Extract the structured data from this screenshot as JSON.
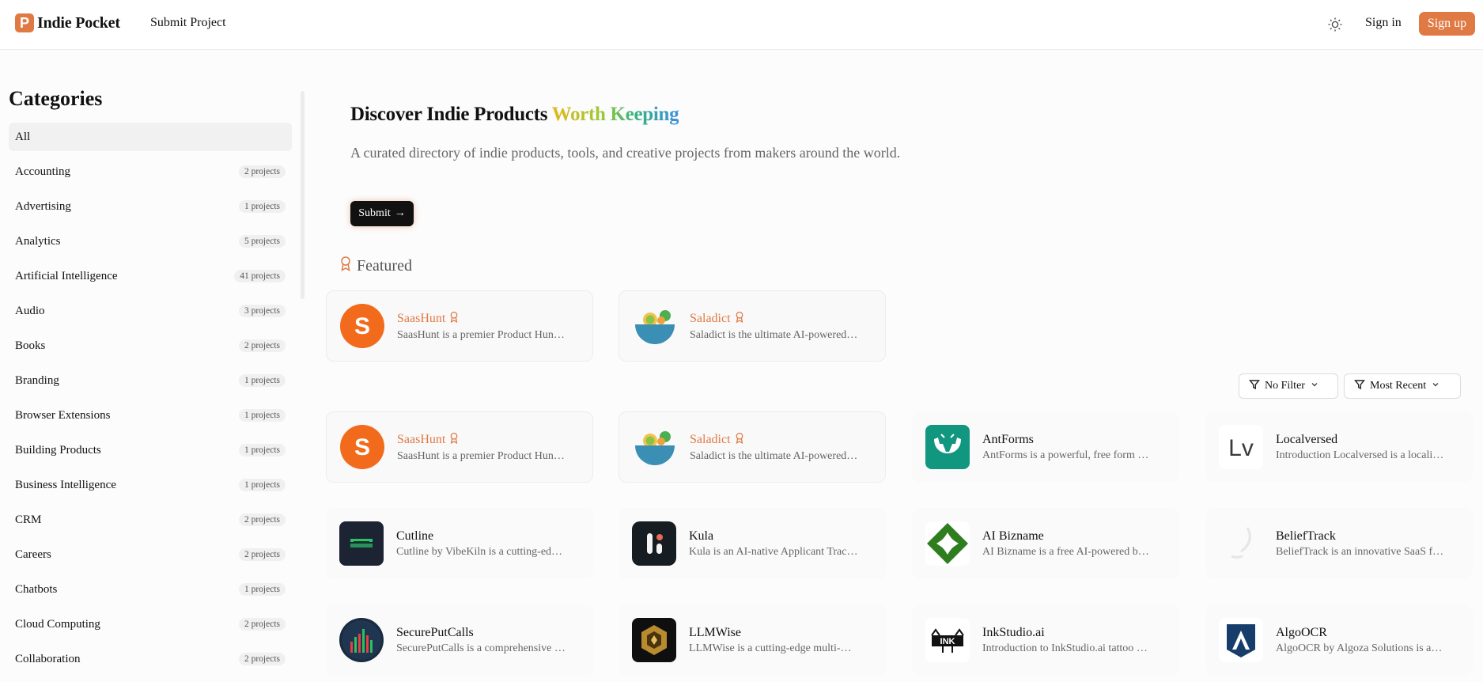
{
  "header": {
    "brand_letter": "P",
    "brand_name": "Indie Pocket",
    "nav_submit": "Submit Project",
    "sign_in": "Sign in",
    "sign_up": "Sign up",
    "accent_color": "#e07a45"
  },
  "sidebar": {
    "title": "Categories",
    "categories": [
      {
        "name": "All",
        "count": ""
      },
      {
        "name": "Accounting",
        "count": "2 projects"
      },
      {
        "name": "Advertising",
        "count": "1 projects"
      },
      {
        "name": "Analytics",
        "count": "5 projects"
      },
      {
        "name": "Artificial Intelligence",
        "count": "41 projects"
      },
      {
        "name": "Audio",
        "count": "3 projects"
      },
      {
        "name": "Books",
        "count": "2 projects"
      },
      {
        "name": "Branding",
        "count": "1 projects"
      },
      {
        "name": "Browser Extensions",
        "count": "1 projects"
      },
      {
        "name": "Building Products",
        "count": "1 projects"
      },
      {
        "name": "Business Intelligence",
        "count": "1 projects"
      },
      {
        "name": "CRM",
        "count": "2 projects"
      },
      {
        "name": "Careers",
        "count": "2 projects"
      },
      {
        "name": "Chatbots",
        "count": "1 projects"
      },
      {
        "name": "Cloud Computing",
        "count": "2 projects"
      },
      {
        "name": "Collaboration",
        "count": "2 projects"
      }
    ]
  },
  "hero": {
    "title_plain": "Discover Indie Products ",
    "title_highlight": "Worth Keeping",
    "description": "A curated directory of indie products, tools, and creative projects from makers around the world.",
    "submit_label": "Submit",
    "submit_arrow": "→"
  },
  "featured": {
    "heading": "Featured",
    "items": [
      {
        "name": "SaasHunt",
        "desc": "SaasHunt is a premier Product Hunt alternative for launching SaaS products",
        "logo": "saashunt"
      },
      {
        "name": "Saladict",
        "desc": "Saladict is the ultimate AI-powered dictionary and translator extension",
        "logo": "saladict"
      }
    ]
  },
  "filters": {
    "filter_label": "No Filter",
    "sort_label": "Most Recent"
  },
  "projects": [
    {
      "name": "SaasHunt",
      "desc": "SaasHunt is a premier Product Hunt alternative for launching SaaS products",
      "logo": "saashunt",
      "featured": true
    },
    {
      "name": "Saladict",
      "desc": "Saladict is the ultimate AI-powered dictionary and translator extension",
      "logo": "saladict",
      "featured": true
    },
    {
      "name": "AntForms",
      "desc": "AntForms is a powerful, free form builder for everyone",
      "logo": "antforms",
      "featured": false
    },
    {
      "name": "Localversed",
      "desc": "Introduction Localversed is a localization platform",
      "logo": "localversed",
      "featured": false
    },
    {
      "name": "Cutline",
      "desc": "Cutline by VibeKiln is a cutting-edge video tool",
      "logo": "cutline",
      "featured": false
    },
    {
      "name": "Kula",
      "desc": "Kula is an AI-native Applicant Tracking System",
      "logo": "kula",
      "featured": false
    },
    {
      "name": "AI Bizname",
      "desc": "AI Bizname is a free AI-powered business name generator",
      "logo": "aibizname",
      "featured": false
    },
    {
      "name": "BeliefTrack",
      "desc": "BeliefTrack is an innovative SaaS for tracking beliefs",
      "logo": "belieftrack",
      "featured": false
    },
    {
      "name": "SecurePutCalls",
      "desc": "SecurePutCalls is a comprehensive options analysis tool",
      "logo": "secureputcalls",
      "featured": false
    },
    {
      "name": "LLMWise",
      "desc": "LLMWise is a cutting-edge multi-model AI platform",
      "logo": "llmwise",
      "featured": false
    },
    {
      "name": "InkStudio.ai",
      "desc": "Introduction to InkStudio.ai tattoo design generator",
      "logo": "inkstudio",
      "featured": false
    },
    {
      "name": "AlgoOCR",
      "desc": "AlgoOCR by Algoza Solutions is an OCR engine",
      "logo": "algoocr",
      "featured": false
    }
  ],
  "logo_texts": {
    "saashunt": "S",
    "localversed": "Lv",
    "inkstudio": "INK"
  }
}
